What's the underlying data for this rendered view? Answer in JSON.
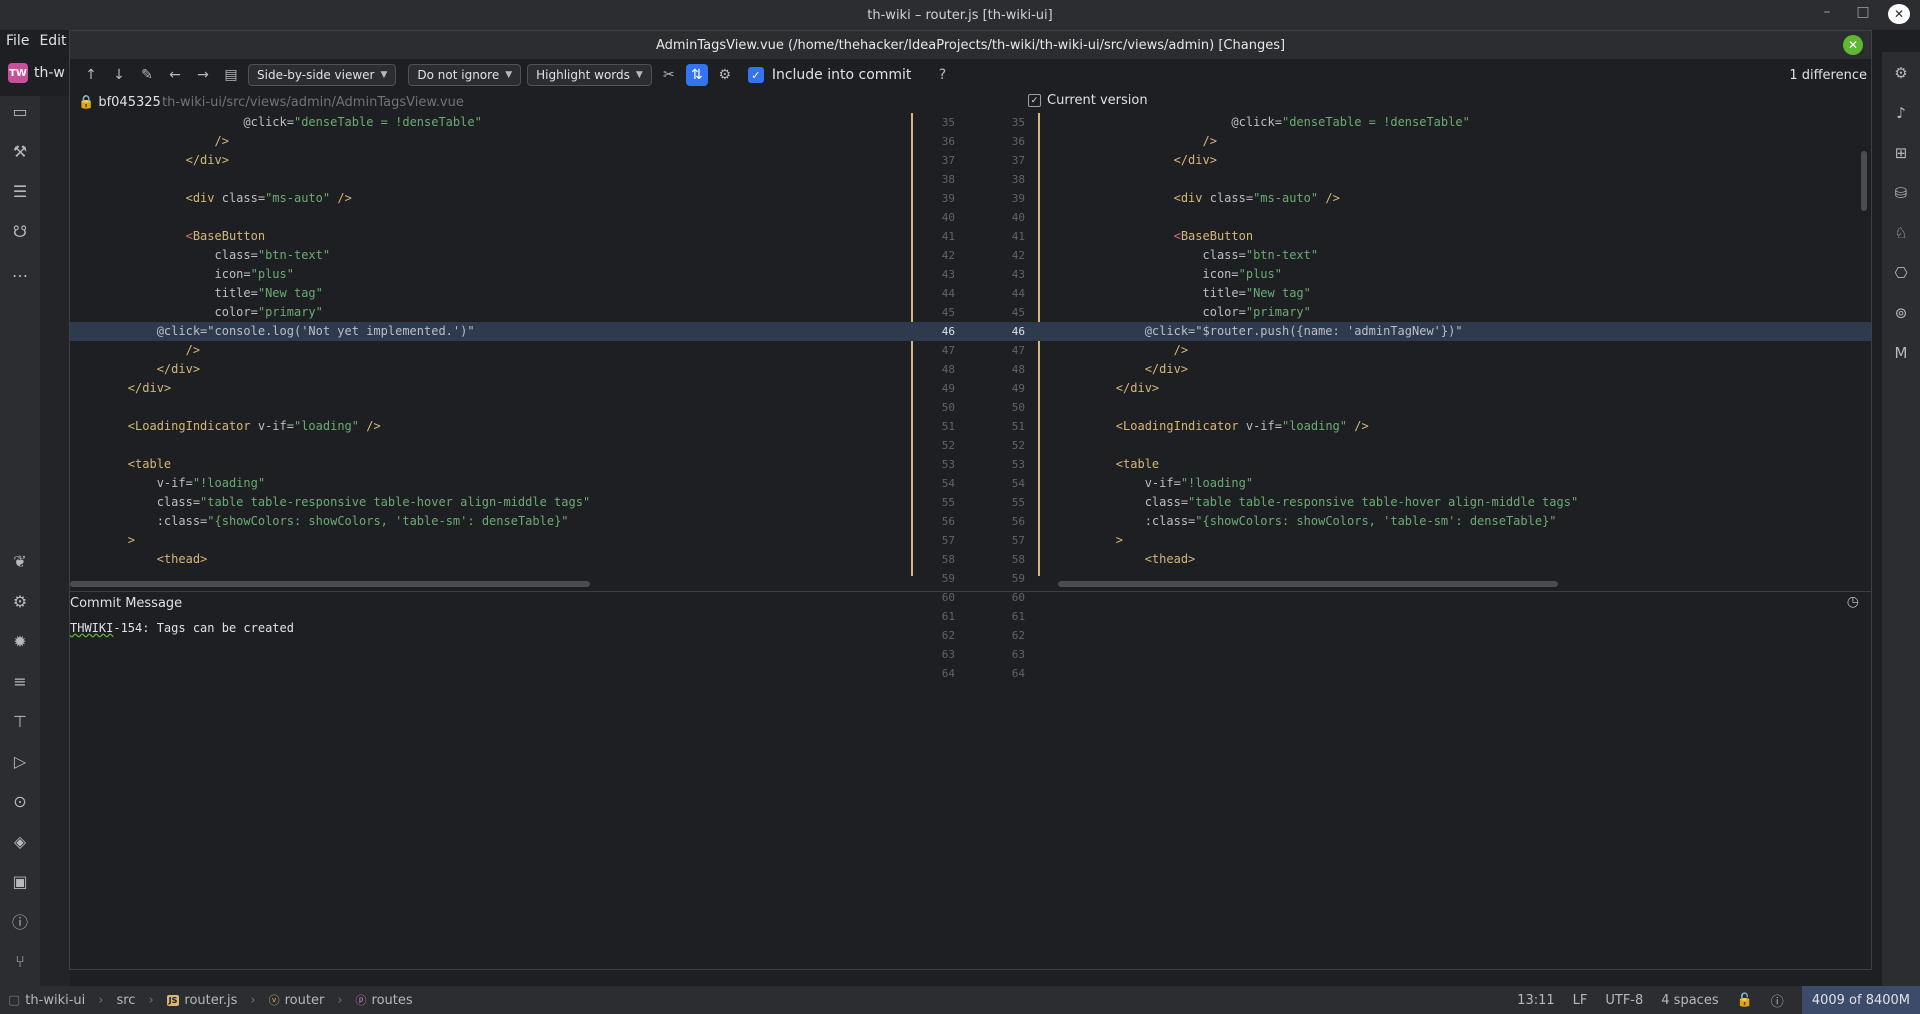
{
  "ide": {
    "window_title": "th-wiki – router.js [th-wiki-ui]",
    "menu": [
      "File",
      "Edit"
    ],
    "project_tab_label": "th-w",
    "project_badge": "TW",
    "behind_labels": [
      "Pro",
      "Git"
    ]
  },
  "dialog": {
    "title": "AdminTagsView.vue (/home/thehacker/IdeaProjects/th-wiki/th-wiki-ui/src/views/admin) [Changes]",
    "viewer_select": "Side-by-side viewer",
    "ignore_select": "Do not ignore",
    "highlight_select": "Highlight words",
    "include_label": "Include into commit",
    "help_label": "?",
    "difference_count": "1 difference",
    "commit_hash": "bf045325",
    "file_path": "th-wiki-ui/src/views/admin/AdminTagsView.vue",
    "current_version_label": "Current version"
  },
  "diff": {
    "line_numbers": [
      "35",
      "36",
      "37",
      "38",
      "39",
      "40",
      "41",
      "42",
      "43",
      "44",
      "45",
      "46",
      "47",
      "48",
      "49",
      "50",
      "51",
      "52",
      "53",
      "54",
      "55",
      "56",
      "57",
      "58",
      "59",
      "60",
      "61",
      "62",
      "63",
      "64"
    ],
    "left_changed_line": "            @click=\"console.log('Not yet implemented.')\"",
    "right_changed_line": "            @click=\"$router.push({name: 'adminTagNew'})\""
  },
  "commit": {
    "header": "Commit Message",
    "message_prefix": "THWIKI",
    "message_rest": "-154: Tags can be created"
  },
  "status": {
    "breadcrumbs": [
      "th-wiki-ui",
      "src",
      "router.js",
      "router",
      "routes"
    ],
    "position": "13:11",
    "line_sep": "LF",
    "encoding": "UTF-8",
    "indent": "4 spaces",
    "memory": "4009 of 8400M"
  },
  "colors": {
    "accent": "#3574f0",
    "close_green": "#5fb832",
    "change_yellow": "#d5b778",
    "change_cyan": "#3fa7c9"
  }
}
